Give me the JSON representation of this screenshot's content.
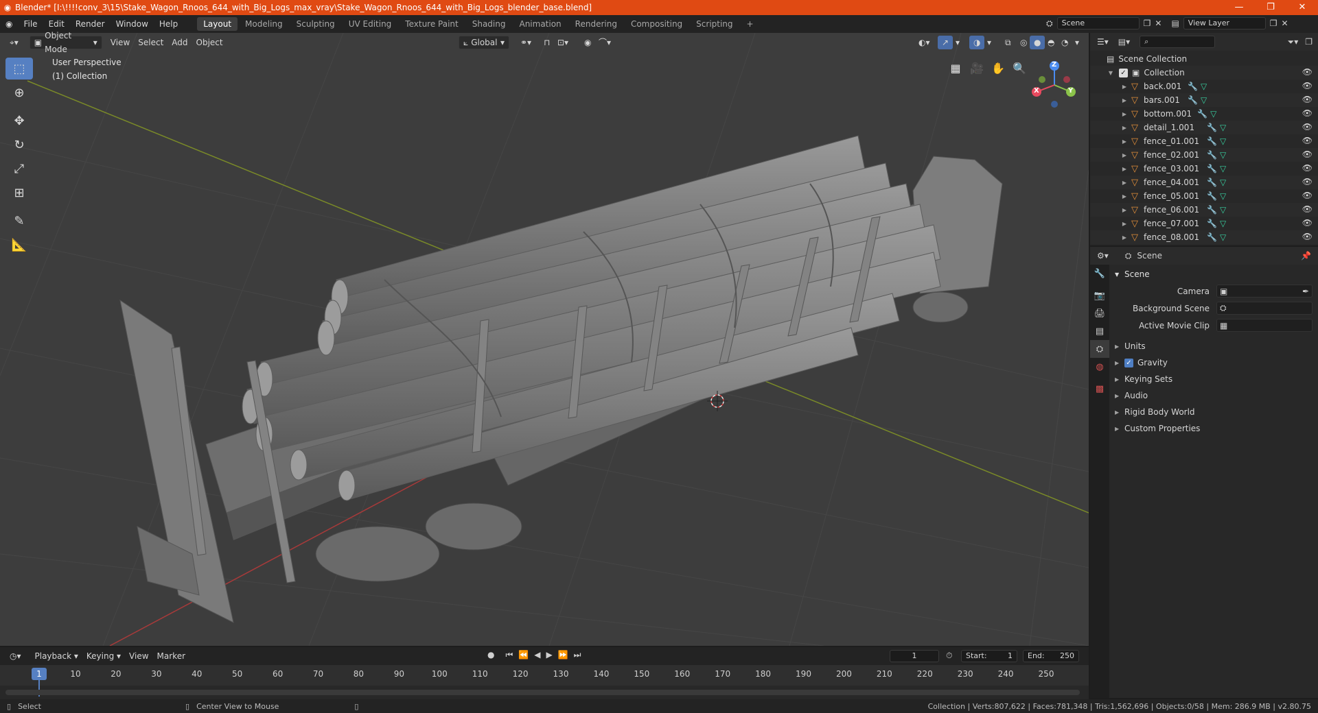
{
  "window": {
    "title": "Blender* [I:\\!!!!conv_3\\15\\Stake_Wagon_Rnoos_644_with_Big_Logs_max_vray\\Stake_Wagon_Rnoos_644_with_Big_Logs_blender_base.blend]",
    "buttons": [
      "—",
      "❐",
      "✕"
    ]
  },
  "menu": [
    "File",
    "Edit",
    "Render",
    "Window",
    "Help"
  ],
  "workspaces": [
    "Layout",
    "Modeling",
    "Sculpting",
    "UV Editing",
    "Texture Paint",
    "Shading",
    "Animation",
    "Rendering",
    "Compositing",
    "Scripting"
  ],
  "active_workspace": "Layout",
  "add_workspace": "+",
  "scene_field": "Scene",
  "view_layer_field": "View Layer",
  "viewport": {
    "mode": "Object Mode",
    "menus": [
      "View",
      "Select",
      "Add",
      "Object"
    ],
    "transform_orientation": "Global",
    "overlay_line1": "User Perspective",
    "overlay_line2": "(1) Collection",
    "gizmo_axes": {
      "x": "X",
      "y": "Y",
      "z": "Z"
    }
  },
  "tools": [
    "select-box",
    "cursor",
    "move",
    "rotate",
    "scale",
    "transform",
    "annotate",
    "measure"
  ],
  "outliner": {
    "search_placeholder": "",
    "root": "Scene Collection",
    "collection": "Collection",
    "objects": [
      "back.001",
      "bars.001",
      "bottom.001",
      "detail_1.001",
      "fence_01.001",
      "fence_02.001",
      "fence_03.001",
      "fence_04.001",
      "fence_05.001",
      "fence_06.001",
      "fence_07.001",
      "fence_08.001"
    ]
  },
  "properties": {
    "context": "Scene",
    "panel": "Scene",
    "rows": [
      {
        "label": "Camera",
        "value": ""
      },
      {
        "label": "Background Scene",
        "value": ""
      },
      {
        "label": "Active Movie Clip",
        "value": ""
      }
    ],
    "subpanels": [
      "Units",
      "Gravity",
      "Keying Sets",
      "Audio",
      "Rigid Body World",
      "Custom Properties"
    ],
    "gravity_checked": true
  },
  "timeline": {
    "menus": [
      "Playback",
      "Keying",
      "View",
      "Marker"
    ],
    "current_frame": "1",
    "start_label": "Start:",
    "start": "1",
    "end_label": "End:",
    "end": "250",
    "ruler": [
      "1",
      "10",
      "20",
      "30",
      "40",
      "50",
      "60",
      "70",
      "80",
      "90",
      "100",
      "110",
      "120",
      "130",
      "140",
      "150",
      "160",
      "170",
      "180",
      "190",
      "200",
      "210",
      "220",
      "230",
      "240",
      "250"
    ]
  },
  "status": {
    "left": "Select",
    "middle": "Center View to Mouse",
    "right": "Collection | Verts:807,622 | Faces:781,348 | Tris:1,562,696 | Objects:0/58 | Mem: 286.9 MB | v2.80.75"
  },
  "colors": {
    "title_bar": "#e04a13",
    "accent": "#5680c2",
    "axis_x": "#e84a5f",
    "axis_y": "#8bc34a",
    "axis_z": "#4a8cf0",
    "object_icon": "#e38f3a",
    "mesh_icon": "#38d0a0"
  }
}
